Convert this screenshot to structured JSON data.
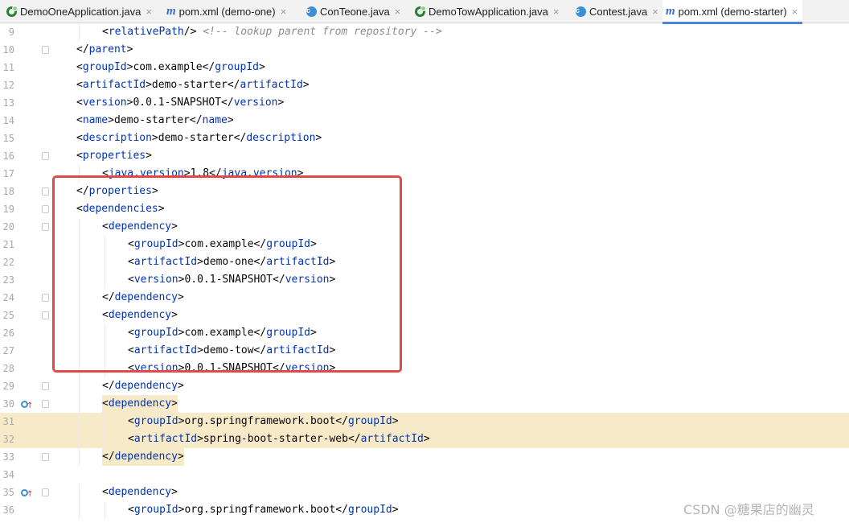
{
  "tabs": [
    {
      "label": "DemoOneApplication.java",
      "icon": "spring-app-icon",
      "active": false
    },
    {
      "label": "pom.xml (demo-one)",
      "icon": "maven-icon",
      "active": false
    },
    {
      "label": "ConTeone.java",
      "icon": "class-icon",
      "active": false
    },
    {
      "label": "DemoTowApplication.java",
      "icon": "spring-app-icon",
      "active": false
    },
    {
      "label": "Contest.java",
      "icon": "class-icon",
      "active": false
    },
    {
      "label": "pom.xml (demo-starter)",
      "icon": "maven-icon",
      "active": true
    }
  ],
  "tab_close_glyph": "×",
  "class_icon_letter": "c",
  "maven_icon_letter": "m",
  "colors": {
    "tag": "#0033b3",
    "text": "#080808",
    "comment": "#8c8c8c",
    "highlight": "#f7eac9",
    "annotation_box": "#e34949",
    "active_tab_underline": "#4a86e8"
  },
  "lines": [
    {
      "num": "9",
      "indent": 2,
      "tag": "relativePath",
      "type": "selfclose",
      "comment": "<!-- lookup parent from repository -->"
    },
    {
      "num": "10",
      "indent": 1,
      "tag": "parent",
      "type": "close",
      "fold": true
    },
    {
      "num": "11",
      "indent": 1,
      "tag": "groupId",
      "type": "element",
      "text": "com.example"
    },
    {
      "num": "12",
      "indent": 1,
      "tag": "artifactId",
      "type": "element",
      "text": "demo-starter"
    },
    {
      "num": "13",
      "indent": 1,
      "tag": "version",
      "type": "element",
      "text": "0.0.1-SNAPSHOT"
    },
    {
      "num": "14",
      "indent": 1,
      "tag": "name",
      "type": "element",
      "text": "demo-starter"
    },
    {
      "num": "15",
      "indent": 1,
      "tag": "description",
      "type": "element",
      "text": "demo-starter"
    },
    {
      "num": "16",
      "indent": 1,
      "tag": "properties",
      "type": "open",
      "fold": true
    },
    {
      "num": "17",
      "indent": 2,
      "tag": "java.version",
      "type": "element",
      "text": "1.8"
    },
    {
      "num": "18",
      "indent": 1,
      "tag": "properties",
      "type": "close",
      "fold": true
    },
    {
      "num": "19",
      "indent": 1,
      "tag": "dependencies",
      "type": "open",
      "fold": true
    },
    {
      "num": "20",
      "indent": 2,
      "tag": "dependency",
      "type": "open",
      "fold": true
    },
    {
      "num": "21",
      "indent": 3,
      "tag": "groupId",
      "type": "element",
      "text": "com.example"
    },
    {
      "num": "22",
      "indent": 3,
      "tag": "artifactId",
      "type": "element",
      "text": "demo-one"
    },
    {
      "num": "23",
      "indent": 3,
      "tag": "version",
      "type": "element",
      "text": "0.0.1-SNAPSHOT"
    },
    {
      "num": "24",
      "indent": 2,
      "tag": "dependency",
      "type": "close",
      "fold": true
    },
    {
      "num": "25",
      "indent": 2,
      "tag": "dependency",
      "type": "open",
      "fold": true
    },
    {
      "num": "26",
      "indent": 3,
      "tag": "groupId",
      "type": "element",
      "text": "com.example"
    },
    {
      "num": "27",
      "indent": 3,
      "tag": "artifactId",
      "type": "element",
      "text": "demo-tow"
    },
    {
      "num": "28",
      "indent": 3,
      "tag": "version",
      "type": "element",
      "text": "0.0.1-SNAPSHOT"
    },
    {
      "num": "29",
      "indent": 2,
      "tag": "dependency",
      "type": "close",
      "fold": true
    },
    {
      "num": "30",
      "indent": 2,
      "tag": "dependency",
      "type": "open",
      "fold": true,
      "gutter_icon": true,
      "highlight": "text"
    },
    {
      "num": "31",
      "indent": 3,
      "tag": "groupId",
      "type": "element",
      "text": "org.springframework.boot",
      "highlight": "full"
    },
    {
      "num": "32",
      "indent": 3,
      "tag": "artifactId",
      "type": "element",
      "text": "spring-boot-starter-web",
      "highlight": "full"
    },
    {
      "num": "33",
      "indent": 2,
      "tag": "dependency",
      "type": "close",
      "fold": true,
      "highlight": "text"
    },
    {
      "num": "34",
      "type": "blank"
    },
    {
      "num": "35",
      "indent": 2,
      "tag": "dependency",
      "type": "open",
      "fold": true,
      "gutter_icon": true
    },
    {
      "num": "36",
      "indent": 3,
      "tag": "groupId",
      "type": "element",
      "text": "org.springframework.boot"
    }
  ],
  "watermark": "CSDN @糖果店的幽灵"
}
